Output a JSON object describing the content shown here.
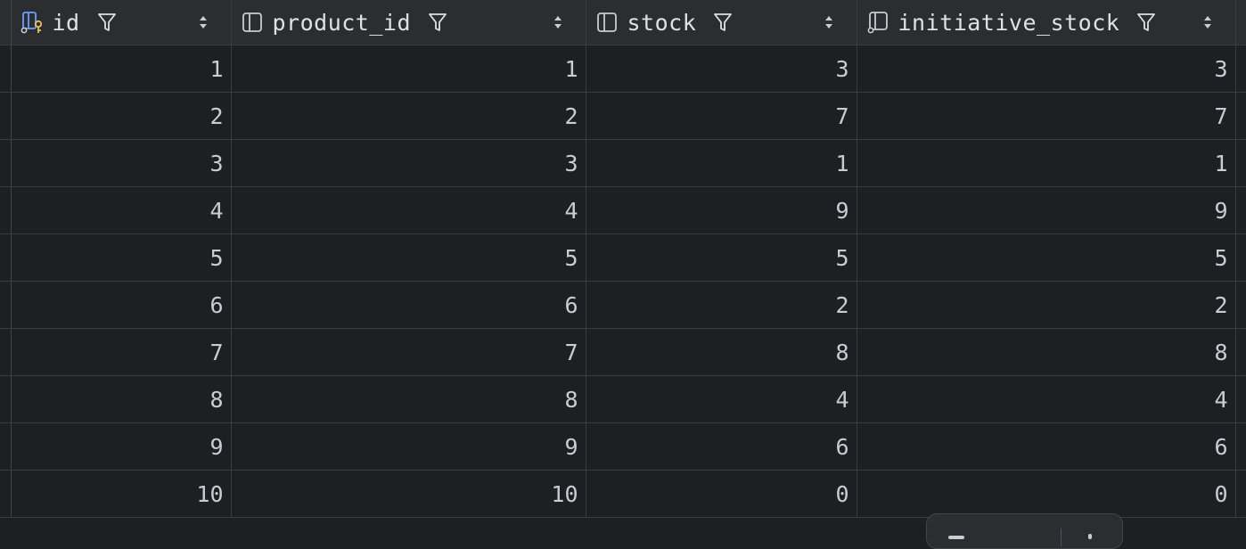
{
  "columns": [
    {
      "name": "id",
      "icon": "primary-key-column-icon"
    },
    {
      "name": "product_id",
      "icon": "column-icon"
    },
    {
      "name": "stock",
      "icon": "column-icon"
    },
    {
      "name": "initiative_stock",
      "icon": "index-column-icon"
    }
  ],
  "rows": [
    [
      "1",
      "1",
      "3",
      "3"
    ],
    [
      "2",
      "2",
      "7",
      "7"
    ],
    [
      "3",
      "3",
      "1",
      "1"
    ],
    [
      "4",
      "4",
      "9",
      "9"
    ],
    [
      "5",
      "5",
      "5",
      "5"
    ],
    [
      "6",
      "6",
      "2",
      "2"
    ],
    [
      "7",
      "7",
      "8",
      "8"
    ],
    [
      "8",
      "8",
      "4",
      "4"
    ],
    [
      "9",
      "9",
      "6",
      "6"
    ],
    [
      "10",
      "10",
      "0",
      "0"
    ]
  ],
  "colors": {
    "background": "#1e1f22",
    "header": "#2b2d30",
    "gridline": "#393b40",
    "text": "#c9ccd2",
    "key_accent": "#e8c25a",
    "column_icon_accent": "#6e9eff"
  }
}
